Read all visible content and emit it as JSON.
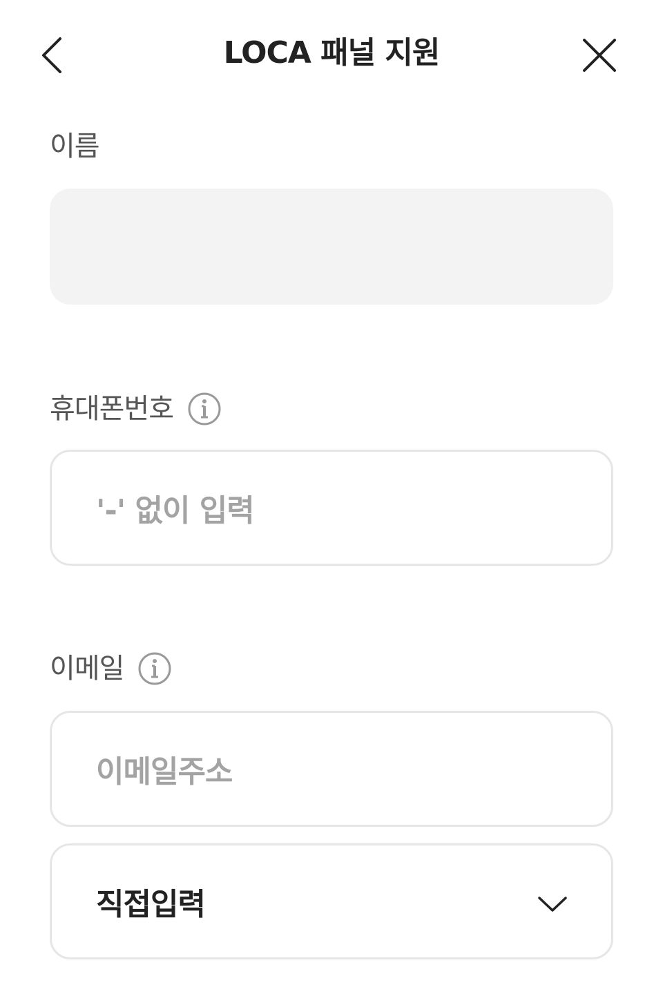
{
  "header": {
    "title": "LOCA 패널 지원",
    "back_icon": "chevron-left-icon",
    "close_icon": "close-icon"
  },
  "form": {
    "name": {
      "label": "이름",
      "value": ""
    },
    "phone": {
      "label": "휴대폰번호",
      "info_icon": "info-icon",
      "placeholder": "'-' 없이 입력"
    },
    "email": {
      "label": "이메일",
      "info_icon": "info-icon",
      "placeholder": "이메일주소",
      "domain_select": "직접입력",
      "domain_icon": "chevron-down-icon"
    }
  },
  "colors": {
    "label": "#555555",
    "placeholder": "#a3a3a3",
    "filled_input_bg": "#f3f3f3",
    "border": "#e6e6e6",
    "text": "#222222"
  }
}
